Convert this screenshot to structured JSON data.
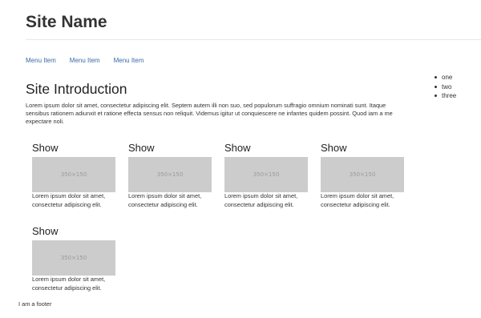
{
  "header": {
    "site_name": "Site Name"
  },
  "menu": {
    "items": [
      "Menu Item",
      "Menu Item",
      "Menu Item"
    ]
  },
  "sidebar": {
    "list": [
      "one",
      "two",
      "three"
    ]
  },
  "intro": {
    "heading": "Site Introduction",
    "body": "Lorem ipsum dolor sit amet, consectetur adipiscing elit. Septem autem illi non suo, sed populorum suffragio omnium nominati sunt. Itaque sensibus rationem adiunxit et ratione effecta sensus non reliquit. Videmus igitur ut conquiescere ne infantes quidem possint. Quod iam a me expectare noli."
  },
  "cards": [
    {
      "title": "Show",
      "image_label": "350×150",
      "text": "Lorem ipsum dolor sit amet, consectetur adipiscing elit."
    },
    {
      "title": "Show",
      "image_label": "350×150",
      "text": "Lorem ipsum dolor sit amet, consectetur adipiscing elit."
    },
    {
      "title": "Show",
      "image_label": "350×150",
      "text": "Lorem ipsum dolor sit amet, consectetur adipiscing elit."
    },
    {
      "title": "Show",
      "image_label": "350×150",
      "text": "Lorem ipsum dolor sit amet, consectetur adipiscing elit."
    },
    {
      "title": "Show",
      "image_label": "350×150",
      "text": "Lorem ipsum dolor sit amet, consectetur adipiscing elit."
    }
  ],
  "footer": {
    "text": "I am a footer"
  },
  "colors": {
    "link": "#3a6aa5",
    "placeholder_bg": "#cccccc",
    "text": "#333333"
  }
}
